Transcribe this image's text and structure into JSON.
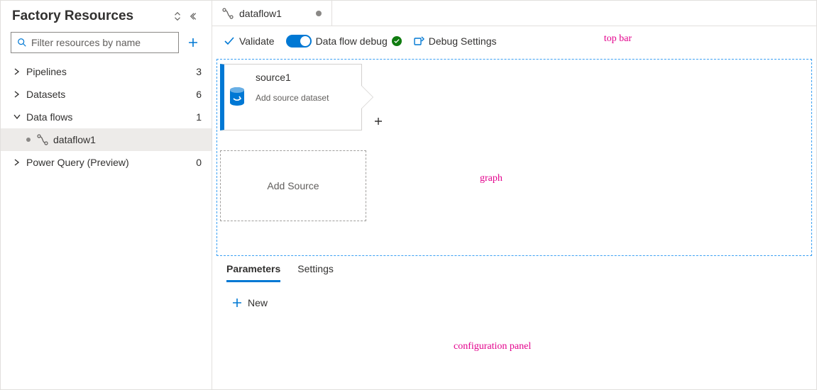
{
  "sidebar": {
    "title": "Factory Resources",
    "filter_placeholder": "Filter resources by name",
    "nodes": [
      {
        "label": "Pipelines",
        "count": "3",
        "expanded": false
      },
      {
        "label": "Datasets",
        "count": "6",
        "expanded": false
      },
      {
        "label": "Data flows",
        "count": "1",
        "expanded": true,
        "children": [
          {
            "label": "dataflow1",
            "active": true
          }
        ]
      },
      {
        "label": "Power Query (Preview)",
        "count": "0",
        "expanded": false
      }
    ]
  },
  "tab": {
    "label": "dataflow1"
  },
  "topbar": {
    "validate": "Validate",
    "debug_label": "Data flow debug",
    "debug_settings": "Debug Settings"
  },
  "annotations": {
    "top": "top bar",
    "graph": "graph",
    "config": "configuration panel"
  },
  "graph": {
    "source_node": {
      "title": "source1",
      "subtitle": "Add source dataset"
    },
    "add_source": "Add Source"
  },
  "config": {
    "tabs": [
      {
        "label": "Parameters",
        "active": true
      },
      {
        "label": "Settings",
        "active": false
      }
    ],
    "new_label": "New"
  }
}
